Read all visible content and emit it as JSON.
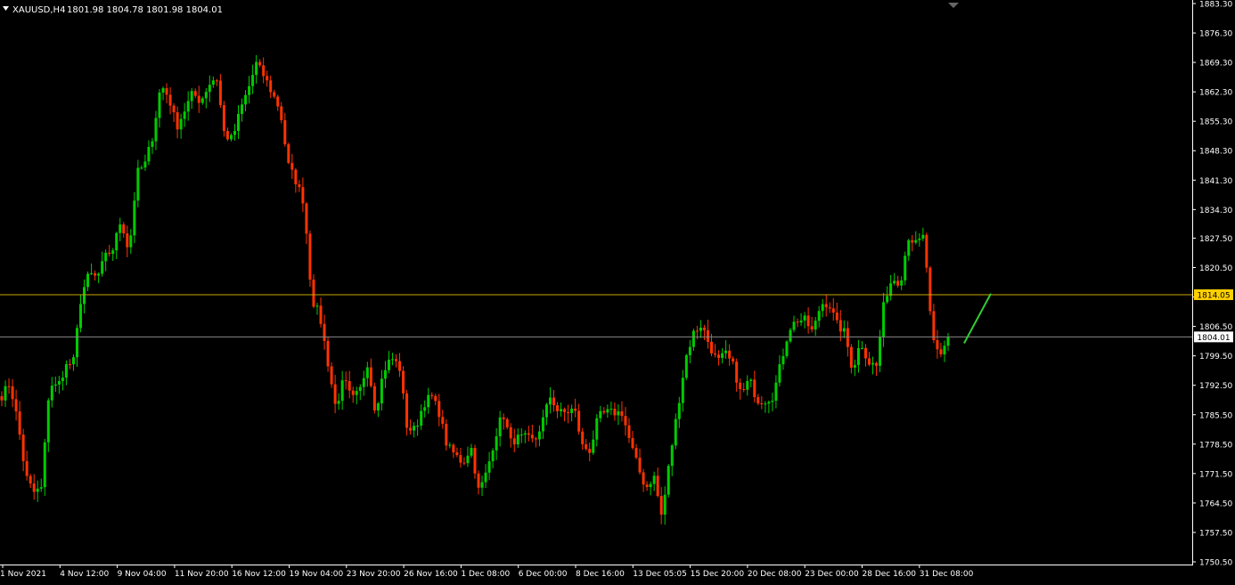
{
  "header": {
    "symbol": "XAUUSD,H4",
    "ohlc": "1801.98 1804.78 1801.98 1804.01"
  },
  "colors": {
    "background": "#000000",
    "bull": "#00cc00",
    "bear": "#ff3300",
    "axis": "#ffffff",
    "hline": "#c8a800",
    "priceline": "#888888",
    "trendline": "#33cc33",
    "label_highlight": "#ffd000"
  },
  "chart_data": {
    "type": "candlestick",
    "symbol": "XAUUSD",
    "timeframe": "H4",
    "ylim": [
      1750.5,
      1883.3
    ],
    "y_ticks": [
      "1883.30",
      "1876.30",
      "1869.30",
      "1862.30",
      "1855.30",
      "1848.30",
      "1841.30",
      "1834.30",
      "1827.50",
      "1820.50",
      "1813.50",
      "1806.50",
      "1799.50",
      "1792.50",
      "1785.50",
      "1778.50",
      "1771.50",
      "1764.50",
      "1757.50",
      "1750.50"
    ],
    "x_ticks": [
      "1 Nov 2021",
      "4 Nov 12:00",
      "9 Nov 04:00",
      "11 Nov 20:00",
      "16 Nov 12:00",
      "19 Nov 04:00",
      "23 Nov 20:00",
      "26 Nov 16:00",
      "1 Dec 08:00",
      "6 Dec 00:00",
      "8 Dec 16:00",
      "13 Dec 05:05",
      "15 Dec 20:00",
      "20 Dec 08:00",
      "23 Dec 00:00",
      "28 Dec 16:00",
      "31 Dec 08:00"
    ],
    "grid": false,
    "current_price": 1804.01,
    "current_price_label": "1804.01",
    "horizontal_line": 1814.05,
    "horizontal_line_label": "1814.05",
    "trend_line": {
      "from": 1802.5,
      "to": 1814.3
    },
    "close_anchors": [
      1790,
      1793,
      1784,
      1771,
      1767,
      1768,
      1793,
      1792,
      1797,
      1798,
      1814,
      1819,
      1818,
      1823,
      1825,
      1832,
      1824,
      1843,
      1845,
      1852,
      1864,
      1861,
      1854,
      1858,
      1862,
      1860,
      1864,
      1866,
      1852,
      1851,
      1858,
      1863,
      1869,
      1866,
      1862,
      1858,
      1845,
      1841,
      1836,
      1813,
      1809,
      1798,
      1787,
      1794,
      1789,
      1791,
      1798,
      1786,
      1796,
      1799,
      1797,
      1782,
      1782,
      1788,
      1790,
      1786,
      1778,
      1776,
      1774,
      1778,
      1767,
      1772,
      1780,
      1786,
      1779,
      1780,
      1780,
      1779,
      1784,
      1790,
      1786,
      1786,
      1787,
      1778,
      1777,
      1785,
      1786,
      1786,
      1786,
      1779,
      1773,
      1768,
      1771,
      1761,
      1775,
      1787,
      1799,
      1805,
      1807,
      1802,
      1798,
      1800,
      1797,
      1790,
      1794,
      1789,
      1789,
      1790,
      1798,
      1806,
      1808,
      1808,
      1805,
      1812,
      1812,
      1807,
      1805,
      1796,
      1803,
      1798,
      1797,
      1813,
      1818,
      1817,
      1828,
      1826,
      1828,
      1803,
      1799,
      1804
    ]
  }
}
